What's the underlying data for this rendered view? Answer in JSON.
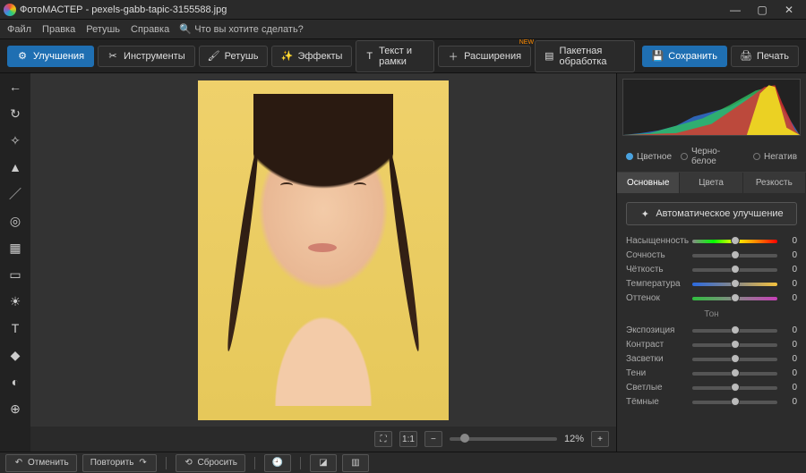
{
  "window": {
    "app_name": "ФотоМАСТЕР",
    "file_name": "pexels-gabb-tapic-3155588.jpg",
    "title_sep": " - "
  },
  "menu": {
    "file": "Файл",
    "edit": "Правка",
    "retouch": "Ретушь",
    "help": "Справка",
    "search_placeholder": "Что вы хотите сделать?"
  },
  "toolbar": {
    "enhance": "Улучшения",
    "tools": "Инструменты",
    "retouch": "Ретушь",
    "effects": "Эффекты",
    "text_frames": "Текст и рамки",
    "extensions": "Расширения",
    "batch": "Пакетная обработка",
    "save": "Сохранить",
    "print": "Печать"
  },
  "zoom": {
    "one_to_one": "1:1",
    "percent": "12%"
  },
  "right": {
    "mode_color": "Цветное",
    "mode_bw": "Черно-белое",
    "mode_neg": "Негатив",
    "tabs": {
      "basic": "Основные",
      "colors": "Цвета",
      "sharp": "Резкость"
    },
    "auto_label": "Автоматическое улучшение",
    "section_tone": "Тон",
    "sliders": {
      "saturation": "Насыщенность",
      "vibrance": "Сочность",
      "clarity": "Чёткость",
      "temperature": "Температура",
      "tint": "Оттенок",
      "exposure": "Экспозиция",
      "contrast": "Контраст",
      "highlights": "Засветки",
      "shadows": "Тени",
      "whites": "Светлые",
      "blacks": "Тёмные"
    },
    "values": {
      "saturation": "0",
      "vibrance": "0",
      "clarity": "0",
      "temperature": "0",
      "tint": "0",
      "exposure": "0",
      "contrast": "0",
      "highlights": "0",
      "shadows": "0",
      "whites": "0",
      "blacks": "0"
    }
  },
  "bottom": {
    "undo": "Отменить",
    "redo": "Повторить",
    "reset": "Сбросить"
  }
}
